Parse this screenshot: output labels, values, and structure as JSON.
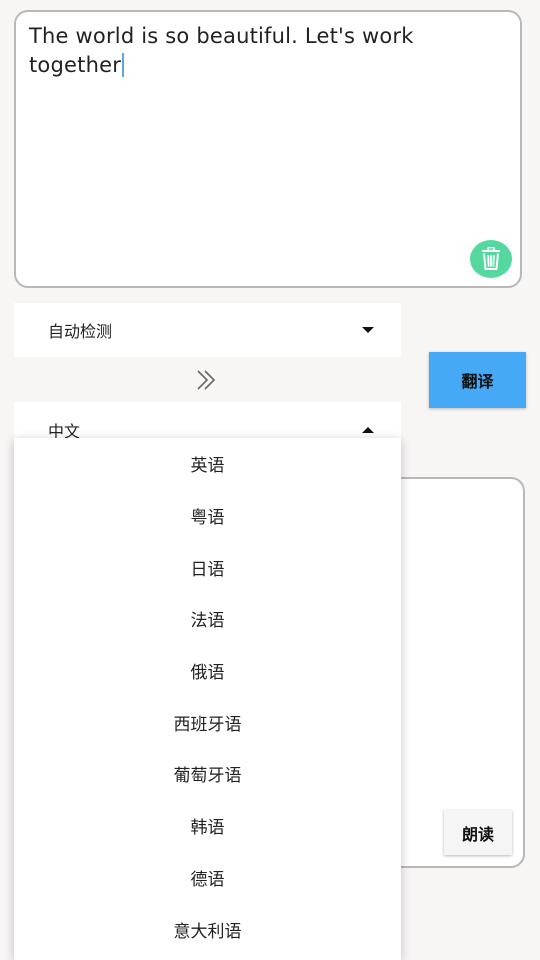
{
  "input": {
    "text": "The world is so beautiful. Let's work together"
  },
  "source_lang": {
    "selected": "自动检测"
  },
  "target_lang": {
    "selected": "中文"
  },
  "buttons": {
    "translate_label": "翻译",
    "read_label": "朗读"
  },
  "dropdown": {
    "items": [
      {
        "label": "英语"
      },
      {
        "label": "粤语"
      },
      {
        "label": "日语"
      },
      {
        "label": "法语"
      },
      {
        "label": "俄语"
      },
      {
        "label": "西班牙语"
      },
      {
        "label": "葡萄牙语"
      },
      {
        "label": "韩语"
      },
      {
        "label": "德语"
      },
      {
        "label": "意大利语"
      }
    ]
  },
  "icons": {
    "clear": "trash-icon",
    "swap": "double-chevron-right-icon"
  },
  "colors": {
    "translate_button": "#45a9f5",
    "clear_button": "#55d8a0",
    "caret": "#5aa7e4"
  }
}
